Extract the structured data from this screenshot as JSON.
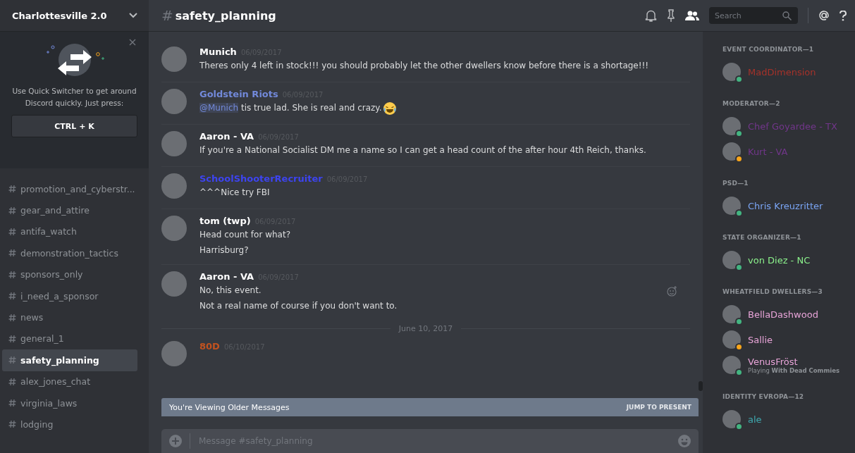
{
  "server": {
    "name": "Charlottesville 2.0"
  },
  "quick_switcher": {
    "text": "Use Quick Switcher to get around Discord quickly. Just press:",
    "shortcut": "CTRL + K"
  },
  "channels": [
    {
      "name": "promotion_and_cyberstr...",
      "selected": false
    },
    {
      "name": "gear_and_attire",
      "selected": false
    },
    {
      "name": "antifa_watch",
      "selected": false
    },
    {
      "name": "demonstration_tactics",
      "selected": false
    },
    {
      "name": "sponsors_only",
      "selected": false
    },
    {
      "name": "i_need_a_sponsor",
      "selected": false
    },
    {
      "name": "news",
      "selected": false
    },
    {
      "name": "general_1",
      "selected": false
    },
    {
      "name": "safety_planning",
      "selected": true
    },
    {
      "name": "alex_jones_chat",
      "selected": false
    },
    {
      "name": "virginia_laws",
      "selected": false
    },
    {
      "name": "lodging",
      "selected": false
    }
  ],
  "header": {
    "hash": "#",
    "channel": "safety_planning",
    "search_placeholder": "Search"
  },
  "messages": [
    {
      "kind": "message",
      "author": "Munich",
      "color": "#ffffff",
      "time": "06/09/2017",
      "lines": [
        {
          "text": "Theres only 4 left in stock!!! you should probably let the other dwellers know before there is a shortage!!!"
        }
      ]
    },
    {
      "kind": "message",
      "author": "Goldstein Riots",
      "color": "#7289da",
      "time": "06/09/2017",
      "lines": [
        {
          "mention": "@Munich",
          "text": " tis true lad. She is real and crazy.",
          "emoji": true
        }
      ]
    },
    {
      "kind": "message",
      "author": "Aaron - VA",
      "color": "#ffffff",
      "time": "06/09/2017",
      "lines": [
        {
          "text": "If you're a National Socialist  DM me a name so I can get a head count of the after hour 4th Reich, thanks."
        }
      ]
    },
    {
      "kind": "message",
      "author": "SchoolShooterRecruiter",
      "color": "#3d44f0",
      "time": "06/09/2017",
      "lines": [
        {
          "text": "^^^Nice try FBI"
        }
      ]
    },
    {
      "kind": "message",
      "author": "tom (twp)",
      "color": "#ffffff",
      "time": "06/09/2017",
      "lines": [
        {
          "text": "Head count for what?"
        },
        {
          "text": "Harrisburg?"
        }
      ]
    },
    {
      "kind": "message",
      "author": "Aaron - VA",
      "color": "#ffffff",
      "time": "06/09/2017",
      "hovered": true,
      "lines": [
        {
          "text": "No, this event."
        },
        {
          "text": "Not a real name of course if you don't want to."
        }
      ]
    },
    {
      "kind": "date",
      "text": "June 10, 2017"
    },
    {
      "kind": "message",
      "author": "80D",
      "color": "#c1521f",
      "time": "06/10/2017"
    }
  ],
  "older_bar": {
    "text": "You're Viewing Older Messages",
    "action": "JUMP TO PRESENT"
  },
  "composer": {
    "placeholder": "Message #safety_planning"
  },
  "member_groups": [
    {
      "title": "EVENT COORDINATOR—1",
      "members": [
        {
          "name": "MadDimension",
          "color": "#a5322a",
          "status_dot": {
            "color": "#43b581"
          }
        }
      ]
    },
    {
      "title": "MODERATOR—2",
      "members": [
        {
          "name": "Chef Goyardee - TX",
          "color": "#71368a",
          "status_dot": {
            "color": "#43b581"
          }
        },
        {
          "name": "Kurt - VA",
          "color": "#71368a",
          "status_dot": {
            "color": "#faa61a"
          }
        }
      ]
    },
    {
      "title": "PSD—1",
      "members": [
        {
          "name": "Chris Kreuzritter",
          "color": "#7aa5f5",
          "status_dot": {
            "color": "#43b581"
          }
        }
      ]
    },
    {
      "title": "STATE ORGANIZER—1",
      "members": [
        {
          "name": "von Diez - NC",
          "color": "#8cf28c",
          "status_dot": {
            "color": "#43b581"
          }
        }
      ]
    },
    {
      "title": "WHEATFIELD DWELLERS—3",
      "members": [
        {
          "name": "BellaDashwood",
          "color": "#e8a4d8",
          "status_dot": {
            "color": "#43b581"
          }
        },
        {
          "name": "Sallie",
          "color": "#e8a4d8",
          "status_dot": {
            "color": "#faa61a"
          }
        },
        {
          "name": "VenusFröst",
          "color": "#e8a4d8",
          "status_dot": {
            "color": "#43b581"
          },
          "activity": "Playing **With Dead Commies**"
        }
      ]
    },
    {
      "title": "IDENTITY EVROPA—12",
      "members": [
        {
          "name": "ale",
          "color": "#3fa9b0",
          "status_dot": {
            "color": "#43b581"
          }
        }
      ]
    }
  ]
}
